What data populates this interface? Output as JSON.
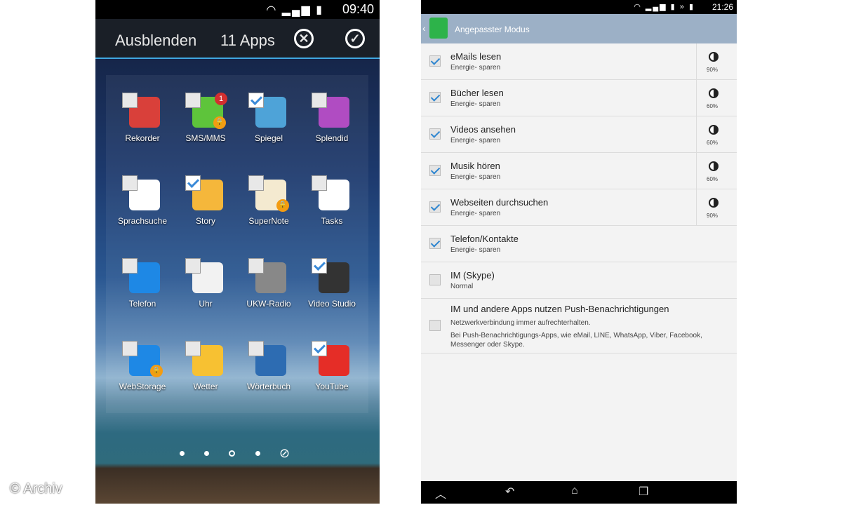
{
  "left_phone": {
    "status_time": "09:40",
    "action_bar": {
      "hide_label": "Ausblenden",
      "count_label": "11 Apps"
    },
    "apps": [
      {
        "label": "Rekorder",
        "checked": false,
        "color": "#d9403a"
      },
      {
        "label": "SMS/MMS",
        "checked": false,
        "color": "#5ec43b",
        "badge": "1",
        "locked": true
      },
      {
        "label": "Spiegel",
        "checked": true,
        "color": "#4ea3d8"
      },
      {
        "label": "Splendid",
        "checked": false,
        "color": "#b04cc2"
      },
      {
        "label": "Sprachsuche",
        "checked": false,
        "color": "#ffffff"
      },
      {
        "label": "Story",
        "checked": true,
        "color": "#f5b73b"
      },
      {
        "label": "SuperNote",
        "checked": false,
        "color": "#f4ead0",
        "locked": true
      },
      {
        "label": "Tasks",
        "checked": false,
        "color": "#ffffff"
      },
      {
        "label": "Telefon",
        "checked": false,
        "color": "#1e88e5"
      },
      {
        "label": "Uhr",
        "checked": false,
        "color": "#f2f2f2"
      },
      {
        "label": "UKW-Radio",
        "checked": false,
        "color": "#888888"
      },
      {
        "label": "Video Studio",
        "checked": true,
        "color": "#333333"
      },
      {
        "label": "WebStorage",
        "checked": false,
        "color": "#1e88e5",
        "locked": true
      },
      {
        "label": "Wetter",
        "checked": false,
        "color": "#f7c132"
      },
      {
        "label": "Wörterbuch",
        "checked": false,
        "color": "#2d6cb2"
      },
      {
        "label": "YouTube",
        "checked": true,
        "color": "#e52d27"
      }
    ]
  },
  "watermark": "© Archiv",
  "right_phone": {
    "status_time": "21:26",
    "header_title": "Angepasster Modus",
    "rows": [
      {
        "title": "eMails lesen",
        "sub": "Energie- sparen",
        "checked": true,
        "brightness": "90%"
      },
      {
        "title": "Bücher lesen",
        "sub": "Energie- sparen",
        "checked": true,
        "brightness": "60%"
      },
      {
        "title": "Videos ansehen",
        "sub": "Energie- sparen",
        "checked": true,
        "brightness": "60%"
      },
      {
        "title": "Musik hören",
        "sub": "Energie- sparen",
        "checked": true,
        "brightness": "60%"
      },
      {
        "title": "Webseiten durchsuchen",
        "sub": "Energie- sparen",
        "checked": true,
        "brightness": "90%"
      },
      {
        "title": "Telefon/Kontakte",
        "sub": "Energie- sparen",
        "checked": true
      },
      {
        "title": "IM (Skype)",
        "sub": "Normal",
        "checked": false
      },
      {
        "title": "IM und andere Apps nutzen Push-Benachrichtigungen",
        "sub": "Netzwerkverbindung immer aufrechterhalten.",
        "note": "Bei Push-Benachrichtigungs-Apps, wie eMail, LINE, WhatsApp, Viber, Facebook, Messenger oder Skype.",
        "checked": false
      }
    ]
  }
}
